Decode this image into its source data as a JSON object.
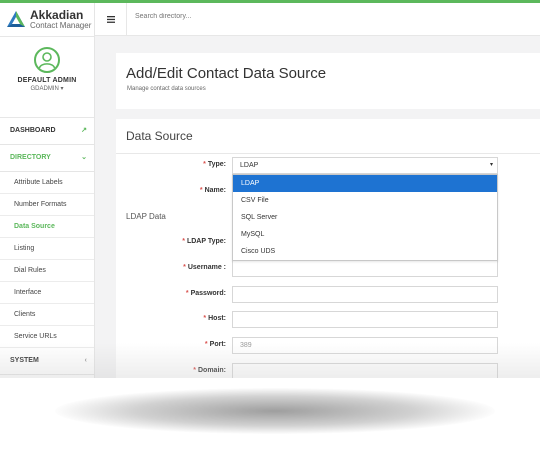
{
  "brand": {
    "name": "Akkadian",
    "subtitle": "Contact Manager"
  },
  "user": {
    "name": "DEFAULT ADMIN",
    "role": "GDADMIN ▾"
  },
  "nav": {
    "dashboard": "DASHBOARD",
    "directory": "DIRECTORY",
    "items": [
      "Attribute Labels",
      "Number Formats",
      "Data Source",
      "Listing",
      "Dial Rules",
      "Interface",
      "Clients",
      "Service URLs"
    ],
    "system": "SYSTEM"
  },
  "topbar": {
    "search_placeholder": "Search directory..."
  },
  "page": {
    "title": "Add/Edit Contact Data Source",
    "subtitle": "Manage contact data sources"
  },
  "form": {
    "section_title": "Data Source",
    "type_label": "Type:",
    "type_value": "LDAP",
    "type_options": [
      "LDAP",
      "CSV File",
      "SQL Server",
      "MySQL",
      "Cisco UDS"
    ],
    "name_label": "Name:",
    "ldap_section": "LDAP Data",
    "ldap_type_label": "LDAP Type:",
    "username_label": "Username :",
    "password_label": "Password:",
    "host_label": "Host:",
    "port_label": "Port:",
    "port_value": "389",
    "domain_label": "Domain:"
  },
  "colors": {
    "accent": "#5cb85c",
    "selected_option": "#1e73d2",
    "required": "#d9534f"
  }
}
